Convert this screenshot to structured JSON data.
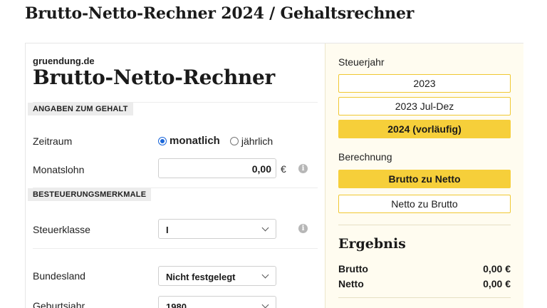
{
  "page": {
    "title": "Brutto-Netto-Rechner 2024 / Gehaltsrechner"
  },
  "calculator": {
    "brand": "gruendung.de",
    "title": "Brutto-Netto-Rechner",
    "sections": {
      "salary": "ANGABEN ZUM GEHALT",
      "tax": "BESTEUERUNGSMERKMALE"
    },
    "period": {
      "label": "Zeitraum",
      "options": [
        {
          "label": "monatlich",
          "checked": true
        },
        {
          "label": "jährlich",
          "checked": false
        }
      ]
    },
    "salary": {
      "label": "Monatslohn",
      "value": "0,00",
      "unit": "€"
    },
    "tax_class": {
      "label": "Steuerklasse",
      "value": "I"
    },
    "state": {
      "label": "Bundesland",
      "value": "Nicht festgelegt"
    },
    "birth_year": {
      "label": "Geburtsjahr",
      "value": "1980"
    },
    "info_icon": "i",
    "accent_color": "#f6cf3a",
    "radio_color": "#1a66d9"
  },
  "sidebar": {
    "tax_year": {
      "label": "Steuerjahr",
      "options": [
        {
          "label": "2023",
          "active": false
        },
        {
          "label": "2023 Jul-Dez",
          "active": false
        },
        {
          "label": "2024 (vorläufig)",
          "active": true
        }
      ]
    },
    "calculation": {
      "label": "Berechnung",
      "options": [
        {
          "label": "Brutto zu Netto",
          "active": true
        },
        {
          "label": "Netto zu Brutto",
          "active": false
        }
      ]
    },
    "result": {
      "title": "Ergebnis",
      "rows": [
        {
          "label": "Brutto",
          "value": "0,00 €"
        },
        {
          "label": "Netto",
          "value": "0,00 €"
        }
      ]
    }
  }
}
